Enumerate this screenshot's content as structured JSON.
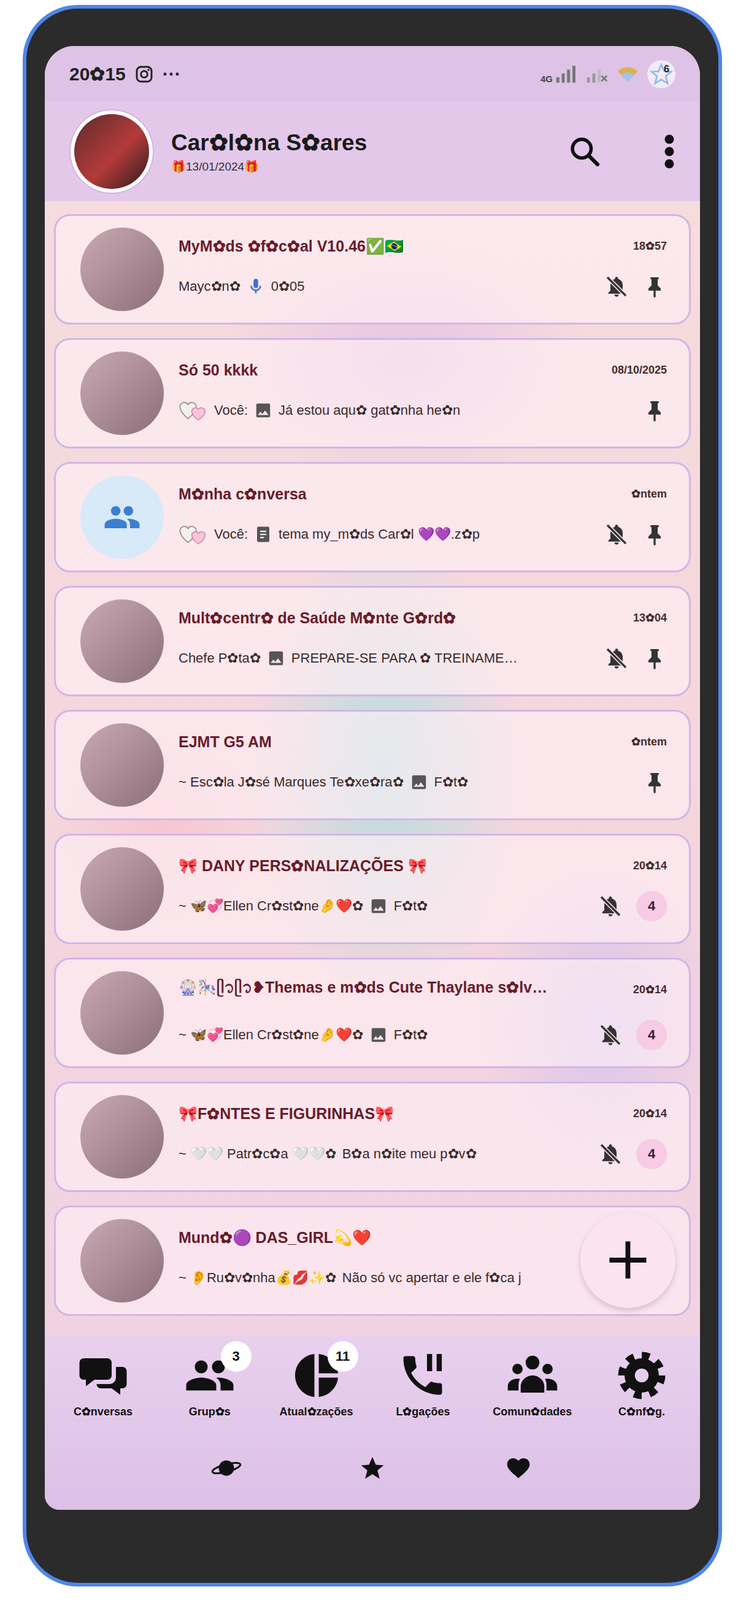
{
  "status_bar": {
    "time": "20✿15",
    "more": "···",
    "network": "4G",
    "notification_count": "6"
  },
  "profile": {
    "name": "Car✿l✿na S✿ares",
    "subtitle": "🎁13/01/2024🎁"
  },
  "chats": [
    {
      "name": "MyM✿ds ✿f✿c✿al V10.46✅🇧🇷",
      "time": "18✿57",
      "avatar": "photo",
      "you": false,
      "sender": "Mayc✿n✿",
      "attachment": "voice",
      "message": "0✿05",
      "muted": true,
      "pinned": true,
      "unread": ""
    },
    {
      "name": "Só 50 kkkk",
      "time": "08/10/2025",
      "avatar": "photo",
      "you": true,
      "sender": "Você:",
      "attachment": "image",
      "message": "Já estou aqu✿ gat✿nha he✿n",
      "muted": false,
      "pinned": true,
      "unread": ""
    },
    {
      "name": "M✿nha c✿nversa",
      "time": "✿ntem",
      "avatar": "group",
      "you": true,
      "sender": "Você:",
      "attachment": "document",
      "message": "tema my_m✿ds Car✿l 💜💜.z✿p",
      "muted": true,
      "pinned": true,
      "unread": ""
    },
    {
      "name": "Mult✿centr✿ de Saúde M✿nte G✿rd✿",
      "time": "13✿04",
      "avatar": "photo",
      "you": false,
      "sender": "Chefe P✿ta✿",
      "attachment": "image",
      "message": "PREPARE-SE PARA ✿ TREINAME…",
      "muted": true,
      "pinned": true,
      "unread": ""
    },
    {
      "name": "EJMT G5 AM",
      "time": "✿ntem",
      "avatar": "photo",
      "you": false,
      "sender": "~ Esc✿la J✿sé Marques Te✿xe✿ra✿",
      "attachment": "image",
      "message": "F✿t✿",
      "muted": false,
      "pinned": true,
      "unread": ""
    },
    {
      "name": "🎀 DANY PERS✿NALIZAÇÕES 🎀",
      "time": "20✿14",
      "avatar": "photo",
      "you": false,
      "sender": "~ 🦋💞Ellen Cr✿st✿ne🤌❤️✿",
      "attachment": "image",
      "message": "F✿t✿",
      "muted": true,
      "pinned": false,
      "unread": "4"
    },
    {
      "name": "🎡🎠ᥫ᭡ᥫ᭡❥Themas e m✿ds Cute Thaylane s✿lv…",
      "time": "20✿14",
      "avatar": "photo",
      "you": false,
      "sender": "~ 🦋💞Ellen Cr✿st✿ne🤌❤️✿",
      "attachment": "image",
      "message": "F✿t✿",
      "muted": true,
      "pinned": false,
      "unread": "4"
    },
    {
      "name": "🎀F✿NTES E FIGURINHAS🎀",
      "time": "20✿14",
      "avatar": "photo",
      "you": false,
      "sender": "~ 🤍🤍 Patr✿c✿a 🤍🤍✿",
      "attachment": "none",
      "message": "B✿a n✿ite meu p✿v✿",
      "muted": true,
      "pinned": false,
      "unread": "4"
    },
    {
      "name": "Mund✿🟣 DAS_GIRL💫❤️",
      "time": "",
      "avatar": "photo",
      "you": false,
      "sender": "~ 👂Ru✿v✿nha💰💋✨✿",
      "attachment": "none",
      "message": "Não só vc apertar e ele f✿ca j",
      "muted": false,
      "pinned": false,
      "unread": ""
    }
  ],
  "fab": {
    "label": "+"
  },
  "nav": [
    {
      "label": "C✿nversas",
      "kind": "chats",
      "badge": ""
    },
    {
      "label": "Grup✿s",
      "kind": "groups",
      "badge": "3"
    },
    {
      "label": "Atual✿zações",
      "kind": "updates",
      "badge": "11"
    },
    {
      "label": "L✿gações",
      "kind": "calls",
      "badge": ""
    },
    {
      "label": "Comun✿dades",
      "kind": "communities",
      "badge": ""
    },
    {
      "label": "C✿nf✿g.",
      "kind": "settings",
      "badge": ""
    }
  ]
}
